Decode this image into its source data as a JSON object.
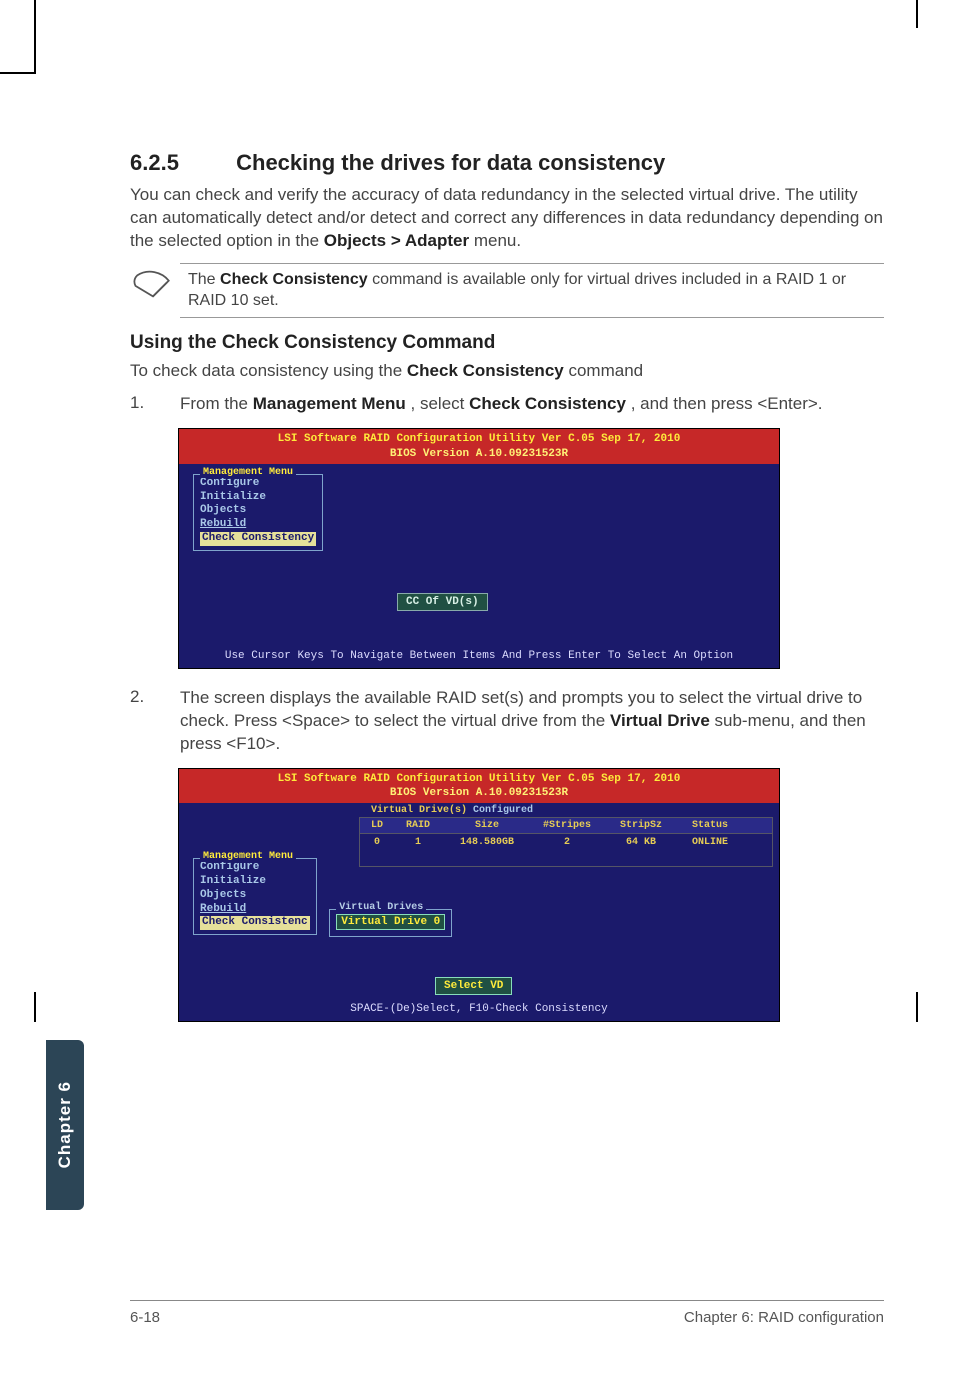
{
  "section": {
    "number": "6.2.5",
    "title": "Checking the drives for data consistency"
  },
  "intro": {
    "p1a": "You can check and verify the accuracy of data redundancy in the selected virtual drive. The utility can automatically detect and/or detect and correct any differences in data redundancy depending on the selected option in the ",
    "p1b": "Objects > Adapter",
    "p1c": " menu."
  },
  "note": {
    "a": "The ",
    "b": "Check Consistency",
    "c": " command is available only for virtual drives included in a RAID 1 or RAID 10 set."
  },
  "sub": {
    "title": "Using the Check Consistency Command"
  },
  "lead": {
    "a": "To check data consistency using the ",
    "b": "Check Consistency",
    "c": " command"
  },
  "steps": {
    "s1": {
      "num": "1.",
      "a": "From the ",
      "b": "Management Menu",
      "c": ", select ",
      "d": "Check Consistency",
      "e": ", and then press <Enter>."
    },
    "s2": {
      "num": "2.",
      "a": "The screen displays the available RAID set(s) and prompts you to select the virtual drive to check. Press <Space> to select the virtual drive from the ",
      "b": "Virtual Drive",
      "c": " sub-menu, and then press <F10>."
    }
  },
  "bios1": {
    "hdr1": "LSI Software RAID Configuration Utility Ver C.05 Sep 17, 2010",
    "hdr2": "BIOS Version   A.10.09231523R",
    "mm_title": "Management Menu",
    "items": [
      "Configure",
      "Initialize",
      "Objects",
      "Rebuild",
      "Check Consistency"
    ],
    "cc": "CC Of VD(s)",
    "ftr": "Use Cursor Keys To Navigate Between Items And Press Enter To Select An Option"
  },
  "bios2": {
    "hdr1": "LSI Software RAID Configuration Utility Ver C.05 Sep 17, 2010",
    "hdr2": "BIOS Version   A.10.09231523R",
    "mm_title": "Management Menu",
    "items": [
      "Configure",
      "Initialize",
      "Objects",
      "Rebuild",
      "Check Consistenc"
    ],
    "tbl_title_a": "Virtual Drive(s) ",
    "tbl_title_b": "Configured",
    "th": {
      "ld": "LD",
      "raid": "RAID",
      "size": "Size",
      "stripes": "#Stripes",
      "stripsz": "StripSz",
      "status": "Status"
    },
    "row": {
      "ld": "0",
      "raid": "1",
      "size": "148.580GB",
      "stripes": "2",
      "stripsz": "64 KB",
      "status": "ONLINE"
    },
    "vd_title": "Virtual Drives",
    "vd_item": "Virtual Drive 0",
    "sel": "Select VD",
    "ftr": "SPACE-(De)Select,    F10-Check Consistency"
  },
  "tab": "Chapter 6",
  "footer": {
    "left": "6-18",
    "right": "Chapter 6: RAID configuration"
  }
}
